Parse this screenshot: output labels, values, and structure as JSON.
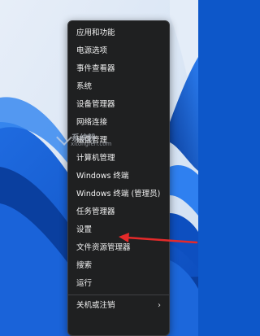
{
  "menu": {
    "items": [
      {
        "label": "应用和功能"
      },
      {
        "label": "电源选项"
      },
      {
        "label": "事件查看器"
      },
      {
        "label": "系统"
      },
      {
        "label": "设备管理器"
      },
      {
        "label": "网络连接"
      },
      {
        "label": "磁盘管理"
      },
      {
        "label": "计算机管理"
      },
      {
        "label": "Windows 终端"
      },
      {
        "label": "Windows 终端 (管理员)"
      },
      {
        "label": "任务管理器"
      },
      {
        "label": "设置"
      },
      {
        "label": "文件资源管理器"
      },
      {
        "label": "搜索"
      },
      {
        "label": "运行"
      },
      {
        "label": "关机或注销",
        "chevron": "›"
      }
    ]
  },
  "watermark": {
    "brand": "系统粉",
    "site": "xitongfen.com"
  },
  "colors": {
    "menu_background": "#1f2021",
    "menu_text": "#f2f2f2",
    "wallpaper": "#0d57c9",
    "arrow": "#e42a2a"
  },
  "icons": {
    "submenu": "chevron-right-icon",
    "watermark": "checkmark-logo-icon",
    "pointer": "red-arrow-annotation"
  }
}
